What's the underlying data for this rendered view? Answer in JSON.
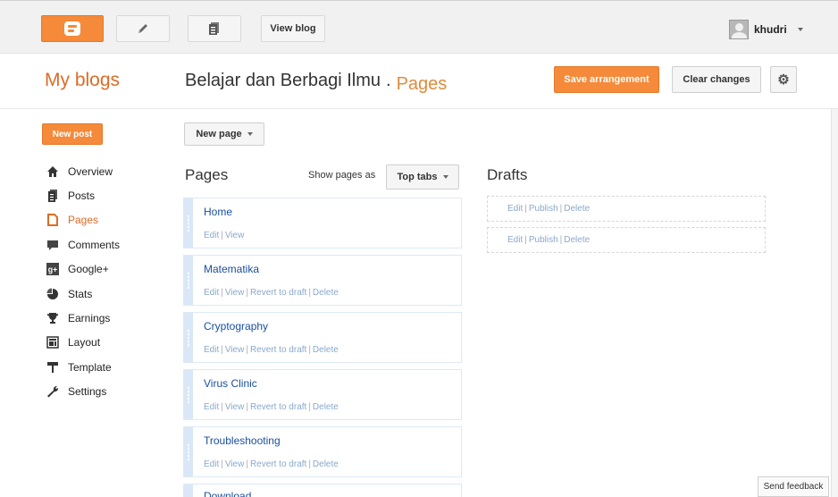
{
  "topbar": {
    "view_blog_label": "View blog",
    "username": "khudri"
  },
  "header": {
    "my_blogs": "My blogs",
    "blog_name": "Belajar dan Berbagi Ilmu",
    "separator": ".",
    "section": "Pages",
    "save_label": "Save arrangement",
    "clear_label": "Clear changes"
  },
  "sidebar": {
    "new_post_label": "New post",
    "items": [
      {
        "label": "Overview",
        "icon": "home-icon"
      },
      {
        "label": "Posts",
        "icon": "posts-icon"
      },
      {
        "label": "Pages",
        "icon": "pages-icon",
        "active": true
      },
      {
        "label": "Comments",
        "icon": "comments-icon"
      },
      {
        "label": "Google+",
        "icon": "google-plus-icon"
      },
      {
        "label": "Stats",
        "icon": "stats-icon"
      },
      {
        "label": "Earnings",
        "icon": "trophy-icon"
      },
      {
        "label": "Layout",
        "icon": "layout-icon"
      },
      {
        "label": "Template",
        "icon": "template-icon"
      },
      {
        "label": "Settings",
        "icon": "wrench-icon"
      }
    ]
  },
  "pages": {
    "new_page_label": "New page",
    "title": "Pages",
    "show_as_label": "Show pages as",
    "show_as_value": "Top tabs",
    "items": [
      {
        "title": "Home",
        "edit": "Edit",
        "view": "View"
      },
      {
        "title": "Matematika",
        "edit": "Edit",
        "view": "View",
        "revert": "Revert to draft",
        "delete": "Delete"
      },
      {
        "title": "Cryptography",
        "edit": "Edit",
        "view": "View",
        "revert": "Revert to draft",
        "delete": "Delete"
      },
      {
        "title": "Virus Clinic",
        "edit": "Edit",
        "view": "View",
        "revert": "Revert to draft",
        "delete": "Delete"
      },
      {
        "title": "Troubleshooting",
        "edit": "Edit",
        "view": "View",
        "revert": "Revert to draft",
        "delete": "Delete"
      },
      {
        "title": "Download"
      }
    ]
  },
  "drafts": {
    "title": "Drafts",
    "items": [
      {
        "edit": "Edit",
        "publish": "Publish",
        "delete": "Delete"
      },
      {
        "edit": "Edit",
        "publish": "Publish",
        "delete": "Delete"
      }
    ]
  },
  "feedback_label": "Send feedback",
  "colors": {
    "accent_orange": "#f48a3a",
    "link_blue": "#1a4fa0",
    "action_blue": "#8aa8cc",
    "card_grip": "#d9e7f6"
  }
}
